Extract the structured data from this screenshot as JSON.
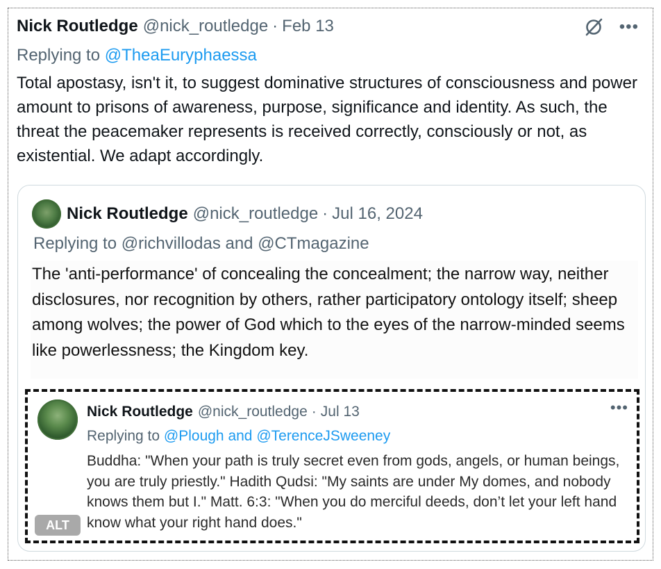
{
  "tweet": {
    "name": "Nick Routledge",
    "handle": "@nick_routledge",
    "separator": "·",
    "date": "Feb 13",
    "replying_prefix": "Replying to",
    "replying_to": "@TheaEuryphaessa",
    "body": "Total apostasy, isn't it, to suggest dominative structures of consciousness and power amount to prisons of awareness, purpose, significance and identity. As such, the threat the peacemaker represents is received correctly, consciously or not, as existential. We adapt accordingly.",
    "icons": {
      "grok": "grok-icon",
      "more": "more-icon"
    },
    "more_glyph": "•••"
  },
  "quote": {
    "name": "Nick Routledge",
    "handle": "@nick_routledge",
    "separator": "·",
    "date": "Jul 16, 2024",
    "replying_line": "Replying to @richvillodas and @CTmagazine",
    "body": "The 'anti-performance' of concealing the concealment; the narrow way, neither disclosures, nor recognition by others, rather participatory ontology itself; sheep among wolves; the power of God which to the eyes of the narrow-minded seems like powerlessness; the Kingdom key."
  },
  "media": {
    "name": "Nick Routledge",
    "handle": "@nick_routledge",
    "separator": "·",
    "date": "Jul 13",
    "more_glyph": "•••",
    "replying_prefix": "Replying to",
    "replying_to": "@Plough and @TerenceJSweeney",
    "body": "Buddha: \"When your path is truly secret even from gods, angels, or human beings, you are truly priestly.\" Hadith Qudsi: \"My saints are under My domes, and nobody knows them but I.\" Matt. 6:3: \"When you do merciful deeds, don’t let your left hand know what your right hand does.\"",
    "alt_label": "ALT"
  },
  "colors": {
    "link": "#1d9bf0",
    "secondary_text": "#536471",
    "primary_text": "#0f1419",
    "border": "#cfd9de",
    "alt_badge": "#a9a9a9"
  }
}
